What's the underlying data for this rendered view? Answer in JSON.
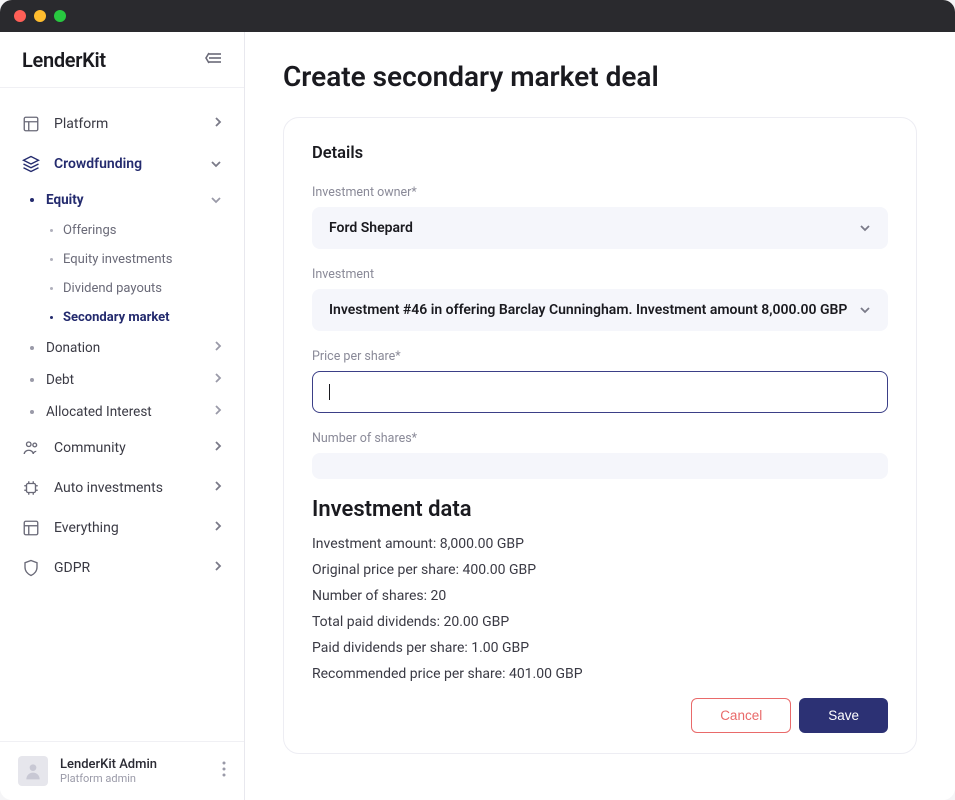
{
  "brand": "LenderKit",
  "sidebar": {
    "items": [
      {
        "label": "Platform"
      },
      {
        "label": "Crowdfunding"
      },
      {
        "label": "Community"
      },
      {
        "label": "Auto investments"
      },
      {
        "label": "Everything"
      },
      {
        "label": "GDPR"
      }
    ],
    "crowdfunding_children": [
      {
        "label": "Equity",
        "expanded": true
      },
      {
        "label": "Donation"
      },
      {
        "label": "Debt"
      },
      {
        "label": "Allocated Interest"
      }
    ],
    "equity_children": [
      {
        "label": "Offerings"
      },
      {
        "label": "Equity investments"
      },
      {
        "label": "Dividend payouts"
      },
      {
        "label": "Secondary market",
        "active": true
      }
    ]
  },
  "user": {
    "name": "LenderKit Admin",
    "role": "Platform admin"
  },
  "page": {
    "title": "Create secondary market deal",
    "details_heading": "Details",
    "fields": {
      "owner_label": "Investment owner*",
      "owner_value": "Ford Shepard",
      "investment_label": "Investment",
      "investment_value": "Investment #46 in offering Barclay Cunningham. Investment amount 8,000.00 GBP",
      "price_label": "Price per share*",
      "price_value": "",
      "shares_label": "Number of shares*",
      "shares_value": ""
    },
    "data_heading": "Investment data",
    "data_rows": {
      "amount": "Investment amount: 8,000.00 GBP",
      "orig_price": "Original price per share: 400.00 GBP",
      "num_shares": "Number of shares: 20",
      "total_div": "Total paid dividends: 20.00 GBP",
      "div_per_share": "Paid dividends per share: 1.00 GBP",
      "rec_price": "Recommended price per share: 401.00 GBP"
    },
    "actions": {
      "cancel": "Cancel",
      "save": "Save"
    }
  }
}
